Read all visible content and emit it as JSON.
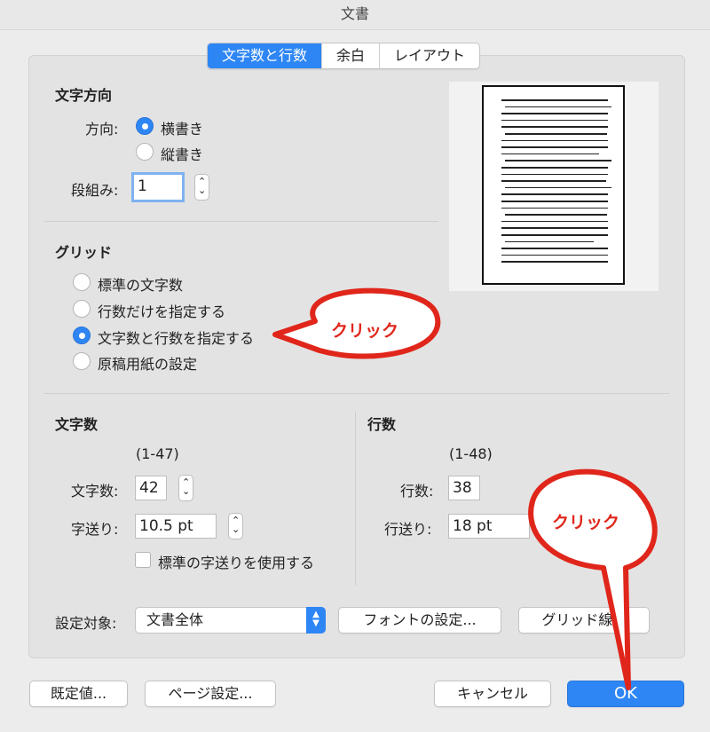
{
  "window": {
    "title": "文書"
  },
  "tabs": [
    {
      "label": "文字数と行数",
      "active": true
    },
    {
      "label": "余白",
      "active": false
    },
    {
      "label": "レイアウト",
      "active": false
    }
  ],
  "direction": {
    "title": "文字方向",
    "direction_label": "方向:",
    "options": [
      {
        "label": "横書き",
        "selected": true
      },
      {
        "label": "縦書き",
        "selected": false
      }
    ],
    "columns_label": "段組み:",
    "columns_value": "1"
  },
  "grid": {
    "title": "グリッド",
    "options": [
      {
        "label": "標準の文字数",
        "selected": false
      },
      {
        "label": "行数だけを指定する",
        "selected": false
      },
      {
        "label": "文字数と行数を指定する",
        "selected": true
      },
      {
        "label": "原稿用紙の設定",
        "selected": false
      }
    ]
  },
  "chars": {
    "title": "文字数",
    "range": "(1-47)",
    "count_label": "文字数:",
    "count_value": "42",
    "pitch_label": "字送り:",
    "pitch_value": "10.5 pt",
    "default_pitch_label": "標準の字送りを使用する"
  },
  "lines": {
    "title": "行数",
    "range": "(1-48)",
    "count_label": "行数:",
    "count_value": "38",
    "pitch_label": "行送り:",
    "pitch_value": "18 pt"
  },
  "apply": {
    "label": "設定対象:",
    "value": "文書全体",
    "font_button": "フォントの設定...",
    "grid_button": "グリッド線..."
  },
  "footer": {
    "default_button": "既定値...",
    "page_setup_button": "ページ設定...",
    "cancel_button": "キャンセル",
    "ok_button": "OK"
  },
  "annotations": {
    "callout1": "クリック",
    "callout2": "クリック",
    "color": "#e0261b"
  },
  "colors": {
    "accent": "#2e86f4"
  }
}
